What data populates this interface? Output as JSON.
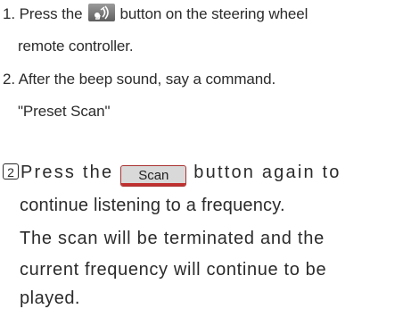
{
  "steps": {
    "step1_a": "1. Press the",
    "step1_b": "button on the steering wheel",
    "step1_c": "remote controller.",
    "step2_a": "2. After the beep sound, say a command.",
    "step2_b": "\"Preset Scan\""
  },
  "voice_button_icon": "voice-recognition-icon",
  "note": {
    "marker": "2",
    "line1_a": "Press the",
    "scan_label": "Scan",
    "line1_b": "button again to",
    "line2": "continue listening to a frequency.",
    "line3": "The scan will be terminated and the",
    "line4": "current frequency will continue to be",
    "line5": "played."
  }
}
